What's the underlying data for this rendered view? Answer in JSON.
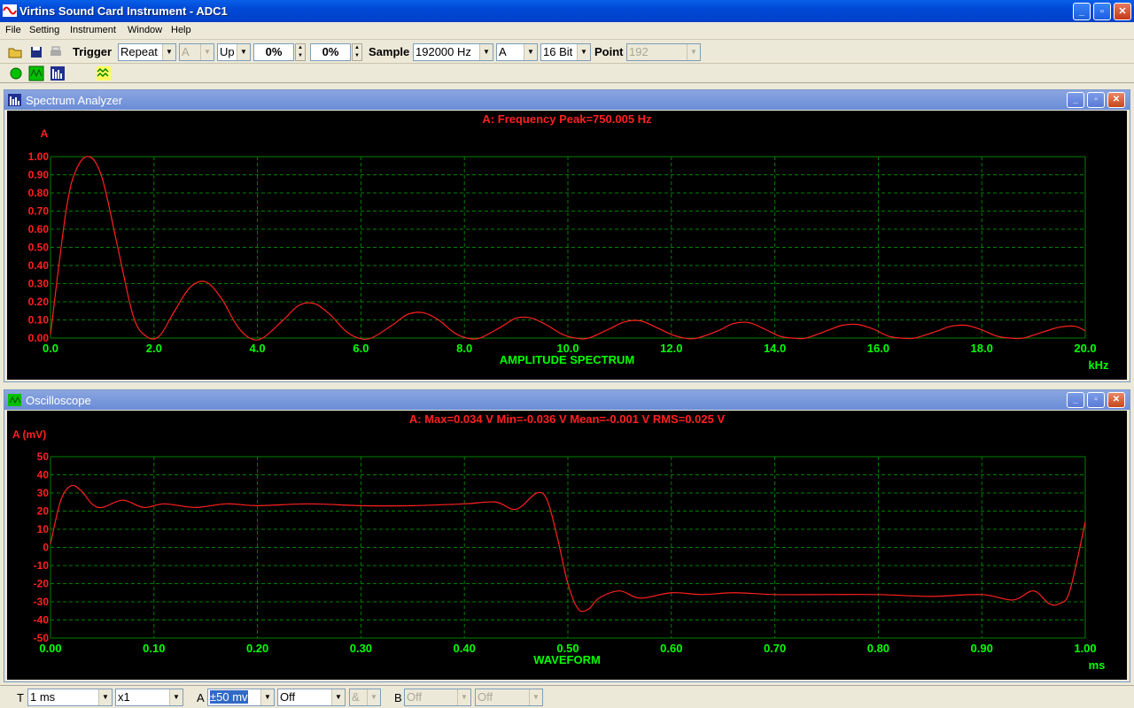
{
  "window": {
    "title": "Virtins Sound Card Instrument - ADC1",
    "min": "_",
    "max": "▫",
    "close": "✕"
  },
  "menu": [
    "File",
    "Setting",
    "Instrument",
    "Window",
    "Help"
  ],
  "toolbar": {
    "trigger_label": "Trigger",
    "trigger_mode": "Repeat",
    "trigger_source": "A",
    "trigger_edge": "Up",
    "level": "0%",
    "delay": "0%",
    "sample_label": "Sample",
    "sample_rate": "192000 Hz",
    "channel": "A",
    "bits": "16 Bit",
    "point_label": "Point",
    "point_value": "192"
  },
  "spectrum": {
    "title": "Spectrum Analyzer",
    "header": "A: Frequency Peak=750.005 Hz",
    "ylabel": "A",
    "xlabel": "AMPLITUDE SPECTRUM",
    "xunit": "kHz",
    "colors": {
      "trace": "#ff2020",
      "grid": "#008000",
      "axis_text": "#00ff00",
      "y_text": "#ff2020"
    }
  },
  "scope": {
    "title": "Oscilloscope",
    "header": "A: Max=0.034 V  Min=-0.036 V    Mean=-0.001 V    RMS=0.025 V",
    "ylabel": "A (mV)",
    "xlabel": "WAVEFORM",
    "xunit": "ms"
  },
  "bottombar": {
    "t_label": "T",
    "timebase": "1 ms",
    "multiplier": "x1",
    "a_label": "A",
    "a_range": "±50 mv",
    "a_coupling": "Off",
    "op": "&",
    "b_label": "B",
    "b_range": "Off",
    "b_coupling": "Off"
  },
  "chart_data": [
    {
      "type": "line",
      "title": "A: Frequency Peak=750.005 Hz",
      "xlabel": "AMPLITUDE SPECTRUM",
      "ylabel": "A",
      "xlim": [
        0,
        20
      ],
      "ylim": [
        0,
        1
      ],
      "x_ticks": [
        "0.0",
        "2.0",
        "4.0",
        "6.0",
        "8.0",
        "10.0",
        "12.0",
        "14.0",
        "16.0",
        "18.0",
        "20.0"
      ],
      "y_ticks": [
        "0.00",
        "0.10",
        "0.20",
        "0.30",
        "0.40",
        "0.50",
        "0.60",
        "0.70",
        "0.80",
        "0.90",
        "1.00"
      ],
      "x": [
        0,
        0.3,
        0.5,
        0.75,
        1.0,
        1.3,
        1.6,
        1.85,
        2.1,
        2.4,
        2.7,
        3.0,
        3.3,
        3.6,
        3.85,
        4.1,
        4.5,
        4.8,
        5.1,
        5.4,
        5.7,
        5.95,
        6.2,
        6.6,
        6.9,
        7.2,
        7.5,
        7.8,
        8.05,
        8.3,
        8.7,
        9.0,
        9.3,
        9.6,
        9.9,
        10.15,
        10.4,
        10.8,
        11.1,
        11.4,
        11.7,
        12.0,
        12.25,
        12.5,
        12.9,
        13.2,
        13.5,
        13.8,
        14.1,
        14.35,
        14.6,
        15.0,
        15.3,
        15.6,
        15.9,
        16.2,
        16.45,
        16.7,
        17.1,
        17.4,
        17.7,
        18.0,
        18.3,
        18.55,
        18.8,
        19.2,
        19.5,
        19.8,
        20.0
      ],
      "series": [
        {
          "values": [
            0.02,
            0.7,
            0.93,
            1.0,
            0.88,
            0.5,
            0.12,
            0.01,
            0.01,
            0.15,
            0.28,
            0.31,
            0.22,
            0.07,
            0.0,
            0.0,
            0.1,
            0.18,
            0.19,
            0.13,
            0.04,
            0.0,
            0.0,
            0.07,
            0.13,
            0.14,
            0.1,
            0.03,
            0.0,
            0.0,
            0.06,
            0.11,
            0.11,
            0.07,
            0.02,
            0.0,
            0.0,
            0.05,
            0.09,
            0.095,
            0.06,
            0.02,
            0.0,
            0.0,
            0.04,
            0.08,
            0.085,
            0.05,
            0.01,
            0.0,
            0.0,
            0.04,
            0.07,
            0.075,
            0.05,
            0.01,
            0.0,
            0.0,
            0.035,
            0.065,
            0.07,
            0.045,
            0.01,
            0.0,
            0.0,
            0.035,
            0.06,
            0.065,
            0.04
          ]
        }
      ]
    },
    {
      "type": "line",
      "title": "A: Max=0.034 V  Min=-0.036 V    Mean=-0.001 V    RMS=0.025 V",
      "xlabel": "WAVEFORM",
      "ylabel": "A (mV)",
      "xlim": [
        0,
        1
      ],
      "ylim": [
        -50,
        50
      ],
      "x_ticks": [
        "0.00",
        "0.10",
        "0.20",
        "0.30",
        "0.40",
        "0.50",
        "0.60",
        "0.70",
        "0.80",
        "0.90",
        "1.00"
      ],
      "y_ticks": [
        "50",
        "40",
        "30",
        "20",
        "10",
        "0",
        "-10",
        "-20",
        "-30",
        "-40",
        "-50"
      ],
      "x": [
        0,
        0.01,
        0.02,
        0.03,
        0.04,
        0.05,
        0.07,
        0.09,
        0.11,
        0.14,
        0.17,
        0.2,
        0.25,
        0.3,
        0.35,
        0.4,
        0.43,
        0.45,
        0.47,
        0.48,
        0.49,
        0.5,
        0.51,
        0.52,
        0.53,
        0.55,
        0.57,
        0.6,
        0.63,
        0.66,
        0.7,
        0.75,
        0.8,
        0.85,
        0.9,
        0.93,
        0.95,
        0.965,
        0.975,
        0.985,
        1.0
      ],
      "series": [
        {
          "values": [
            2,
            26,
            34,
            31,
            24,
            22,
            26,
            22,
            24,
            22,
            24,
            23,
            24,
            23,
            23,
            24,
            25,
            21,
            30,
            26,
            5,
            -20,
            -34,
            -34,
            -28,
            -24,
            -28,
            -25,
            -26,
            -25,
            -26,
            -26,
            -26,
            -27,
            -26,
            -29,
            -24,
            -31,
            -31,
            -24,
            14
          ]
        }
      ]
    }
  ]
}
